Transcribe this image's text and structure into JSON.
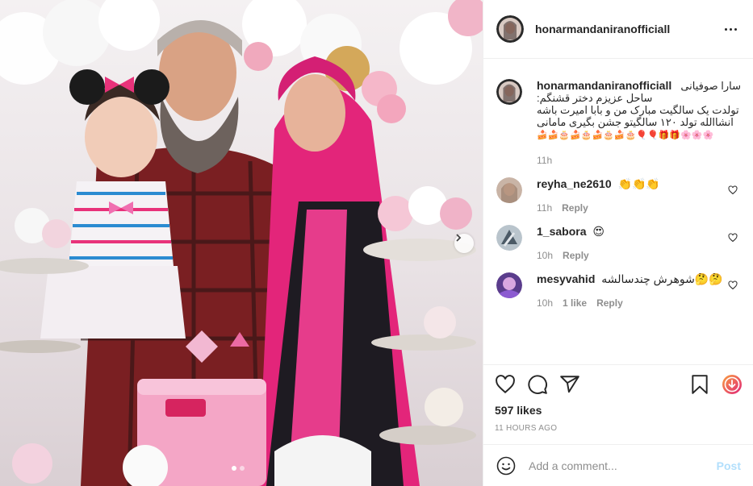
{
  "post": {
    "author": "honarmandaniranofficiall",
    "likes": "597 likes",
    "timestamp": "11 HOURS AGO"
  },
  "caption": {
    "user": "honarmandaniranofficiall",
    "lines": [
      "سارا صوفیانی",
      "ساحل عزیزم دختر قشنگم:",
      "تولدت یک سالگیت مبارک من و بابا امیرت باشه",
      "انشاالله تولد ۱۲۰ سالگیتو جشن بگیری مامانی",
      "🍰🍰🎂🍰🎂🍰🎂🍰🎂🎈🎈🎁🎁🌸🌸🌸"
    ],
    "time": "11h"
  },
  "comments": [
    {
      "user": "reyha_ne2610",
      "text": "👏👏👏",
      "time": "11h",
      "likes": "",
      "reply": "Reply"
    },
    {
      "user": "1_sabora",
      "text": "😍",
      "time": "10h",
      "likes": "",
      "reply": "Reply"
    },
    {
      "user": "mesyvahid",
      "text": "شوهرش چندسالشه🤔🤔",
      "time": "10h",
      "likes": "1 like",
      "reply": "Reply"
    }
  ],
  "add_comment": {
    "placeholder": "Add a comment...",
    "post_label": "Post"
  },
  "colors": {
    "accent": "#0095f6",
    "post_disabled": "#b2dffc",
    "muted": "#8e8e8e",
    "text": "#262626"
  }
}
